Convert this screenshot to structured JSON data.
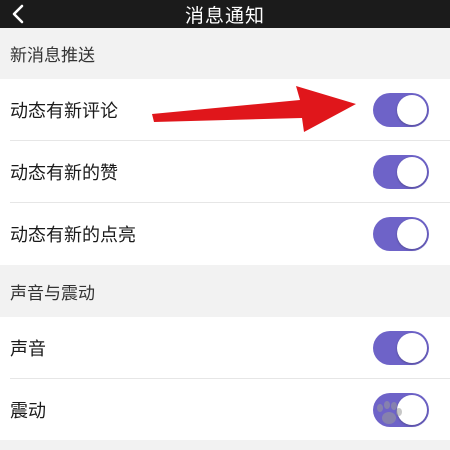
{
  "header": {
    "title": "消息通知",
    "back_icon": "chevron-left-icon"
  },
  "sections": [
    {
      "title": "新消息推送",
      "items": [
        {
          "label": "动态有新评论",
          "toggle_on": true
        },
        {
          "label": "动态有新的赞",
          "toggle_on": true
        },
        {
          "label": "动态有新的点亮",
          "toggle_on": true
        }
      ]
    },
    {
      "title": "声音与震动",
      "items": [
        {
          "label": "声音",
          "toggle_on": true
        },
        {
          "label": "震动",
          "toggle_on": true
        }
      ]
    }
  ],
  "colors": {
    "toggle_on": "#6e63c8",
    "header_bg": "#1b1b1b",
    "section_bg": "#f2f2f2",
    "annotation_arrow": "#e0161b"
  },
  "annotation": {
    "arrow_icon": "red-arrow-annotation"
  },
  "watermark": {
    "icon": "baidu-jingyan-watermark"
  }
}
